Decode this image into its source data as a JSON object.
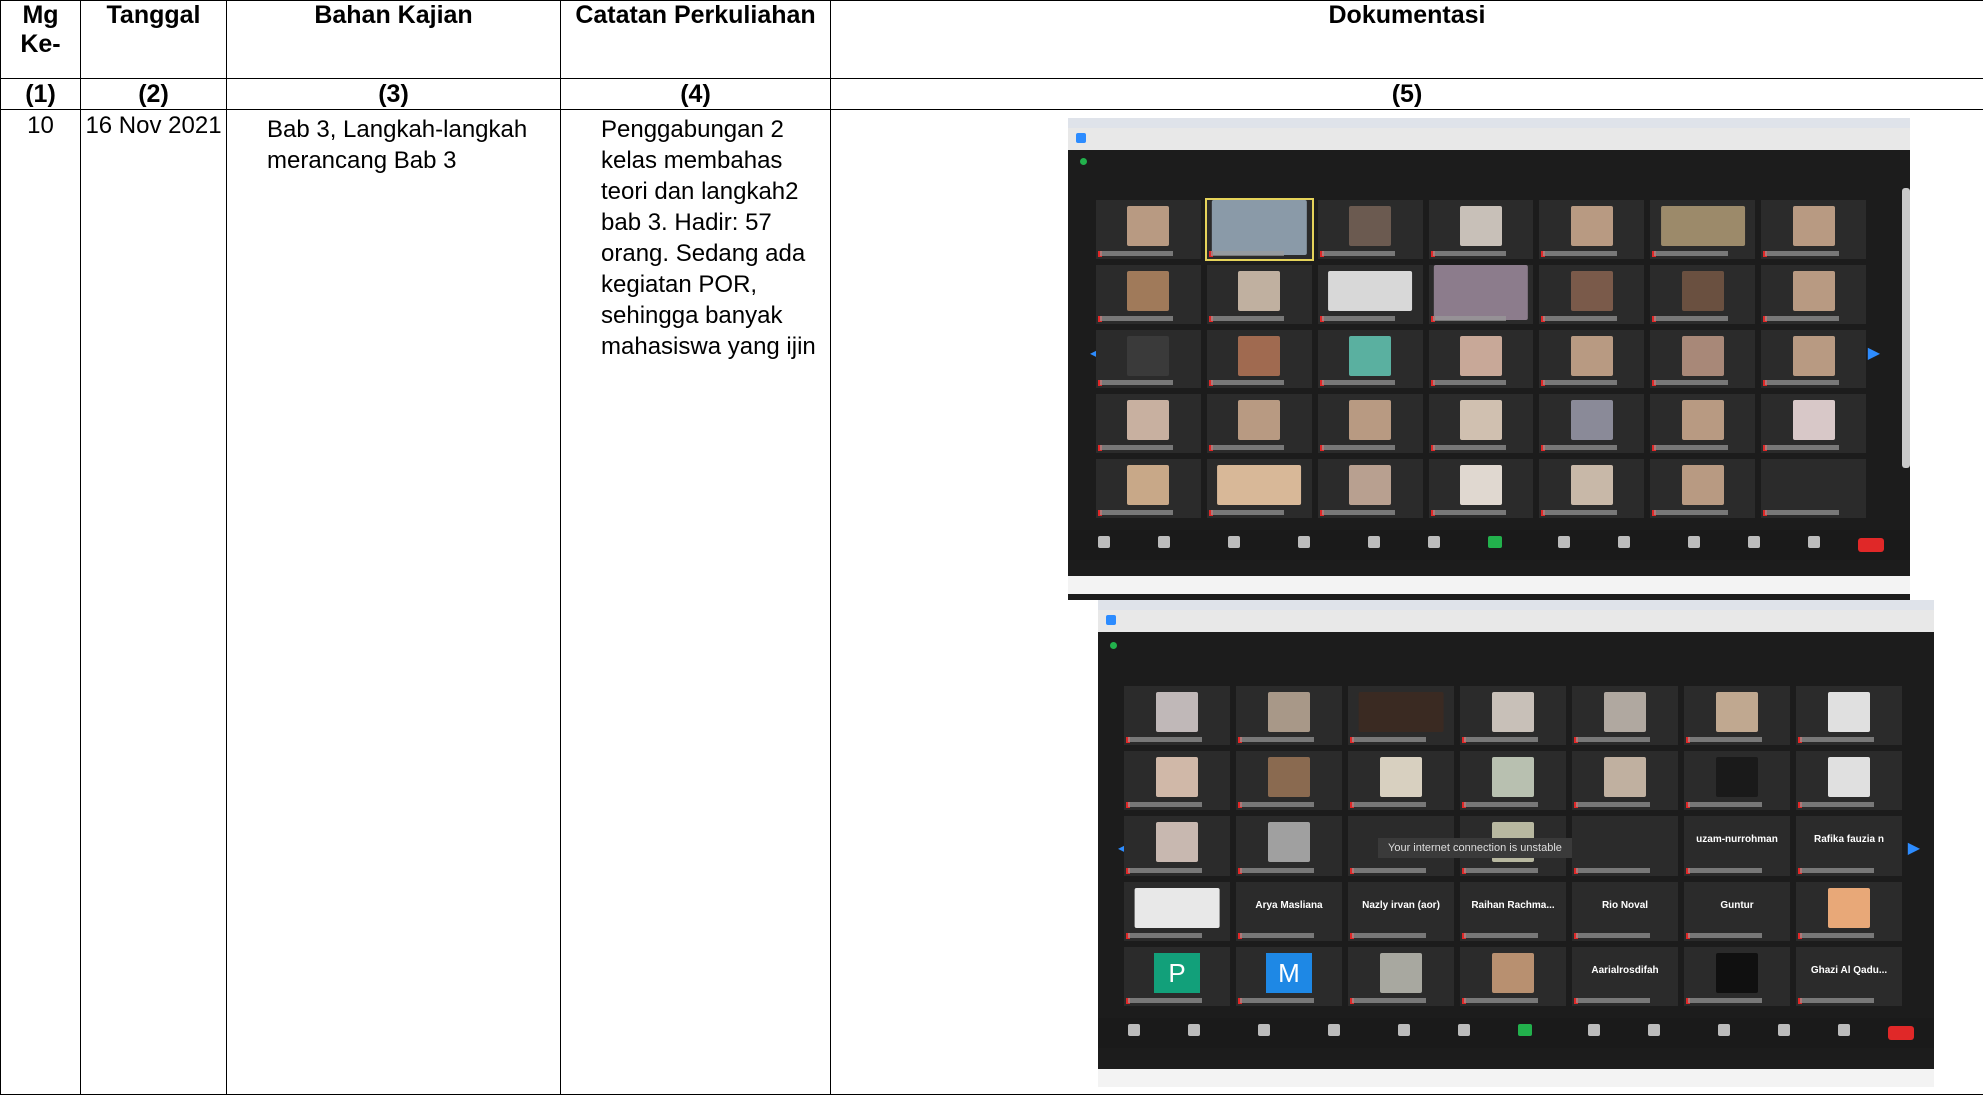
{
  "headers": {
    "mg": "Mg Ke-",
    "tanggal": "Tanggal",
    "bahan": "Bahan Kajian",
    "catatan": "Catatan Perkuliahan",
    "dokumentasi": "Dokumentasi"
  },
  "column_numbers": [
    "(1)",
    "(2)",
    "(3)",
    "(4)",
    "(5)"
  ],
  "row": {
    "mg": "10",
    "tanggal": "16 Nov 2021",
    "bahan": "Bab 3, Langkah-langkah merancang Bab 3",
    "catatan": "Penggabungan 2 kelas membahas teori dan langkah2 bab 3. Hadir: 57 orang. Sedang ada kegiatan POR, sehingga banyak mahasiswa yang ijin"
  },
  "screenshot2": {
    "toast": "Your internet connection is unstable",
    "tiles_text": [
      "Arya Masliana",
      "Nazly irvan (aor)",
      "Raihan Rachma...",
      "Rio Noval",
      "Guntur",
      "Aarialrosdifah",
      "Ghazi Al Qadu...",
      "uzam-nurrohman",
      "Rafika fauzia n"
    ],
    "avatars": [
      "P",
      "M"
    ]
  },
  "colors": {
    "zoom_bg": "#1c1c1c",
    "accent_blue": "#2d8cff",
    "end_red": "#e02828",
    "share_green": "#22b14c"
  }
}
